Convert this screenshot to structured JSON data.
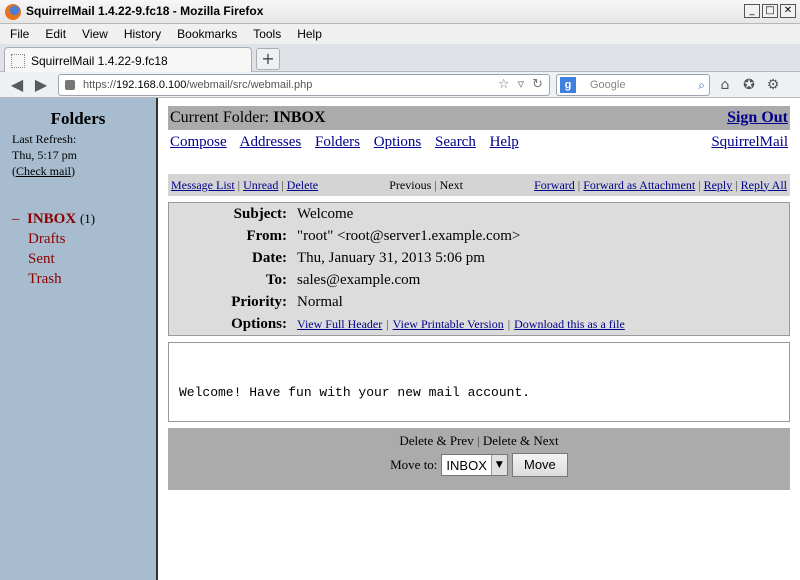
{
  "window": {
    "title": "SquirrelMail 1.4.22-9.fc18 - Mozilla Firefox",
    "controls": [
      "_",
      "□",
      "✕"
    ]
  },
  "menubar": {
    "items": [
      "File",
      "Edit",
      "View",
      "History",
      "Bookmarks",
      "Tools",
      "Help"
    ]
  },
  "tab": {
    "title": "SquirrelMail 1.4.22-9.fc18",
    "new_tab_label": "+"
  },
  "navbar": {
    "url_prefix": "https://",
    "url_host": "192.168.0.100",
    "url_path": "/webmail/src/webmail.php",
    "search_placeholder": "Google",
    "search_engine_letter": "g"
  },
  "sidebar": {
    "title": "Folders",
    "last_refresh_label": "Last Refresh:",
    "last_refresh_time": "Thu, 5:17 pm",
    "check_mail_label": "Check mail",
    "collapse_marker": "–",
    "inbox": {
      "name": "INBOX",
      "count": "(1)"
    },
    "folders": [
      "Drafts",
      "Sent",
      "Trash"
    ]
  },
  "main": {
    "current_folder_label": "Current Folder:",
    "current_folder": "INBOX",
    "sign_out": "Sign Out",
    "nav_links": [
      "Compose",
      "Addresses",
      "Folders",
      "Options",
      "Search",
      "Help"
    ],
    "brand_link": "SquirrelMail",
    "actions": {
      "message_list": "Message List",
      "unread": "Unread",
      "delete": "Delete",
      "previous": "Previous",
      "next": "Next",
      "forward": "Forward",
      "forward_attachment": "Forward as Attachment",
      "reply": "Reply",
      "reply_all": "Reply All"
    },
    "headers": {
      "subject_label": "Subject:",
      "subject": "Welcome",
      "from_label": "From:",
      "from": "\"root\" <root@server1.example.com>",
      "date_label": "Date:",
      "date": "Thu, January 31, 2013 5:06 pm",
      "to_label": "To:",
      "to": "sales@example.com",
      "priority_label": "Priority:",
      "priority": "Normal",
      "options_label": "Options:",
      "view_full_header": "View Full Header",
      "view_printable": "View Printable Version",
      "download": "Download this as a file"
    },
    "body_text": "Welcome! Have fun with your new mail account.",
    "footer": {
      "delete_prev": "Delete & Prev",
      "delete_next": "Delete & Next",
      "move_to_label": "Move to:",
      "move_to_value": "INBOX",
      "move_button": "Move"
    }
  }
}
